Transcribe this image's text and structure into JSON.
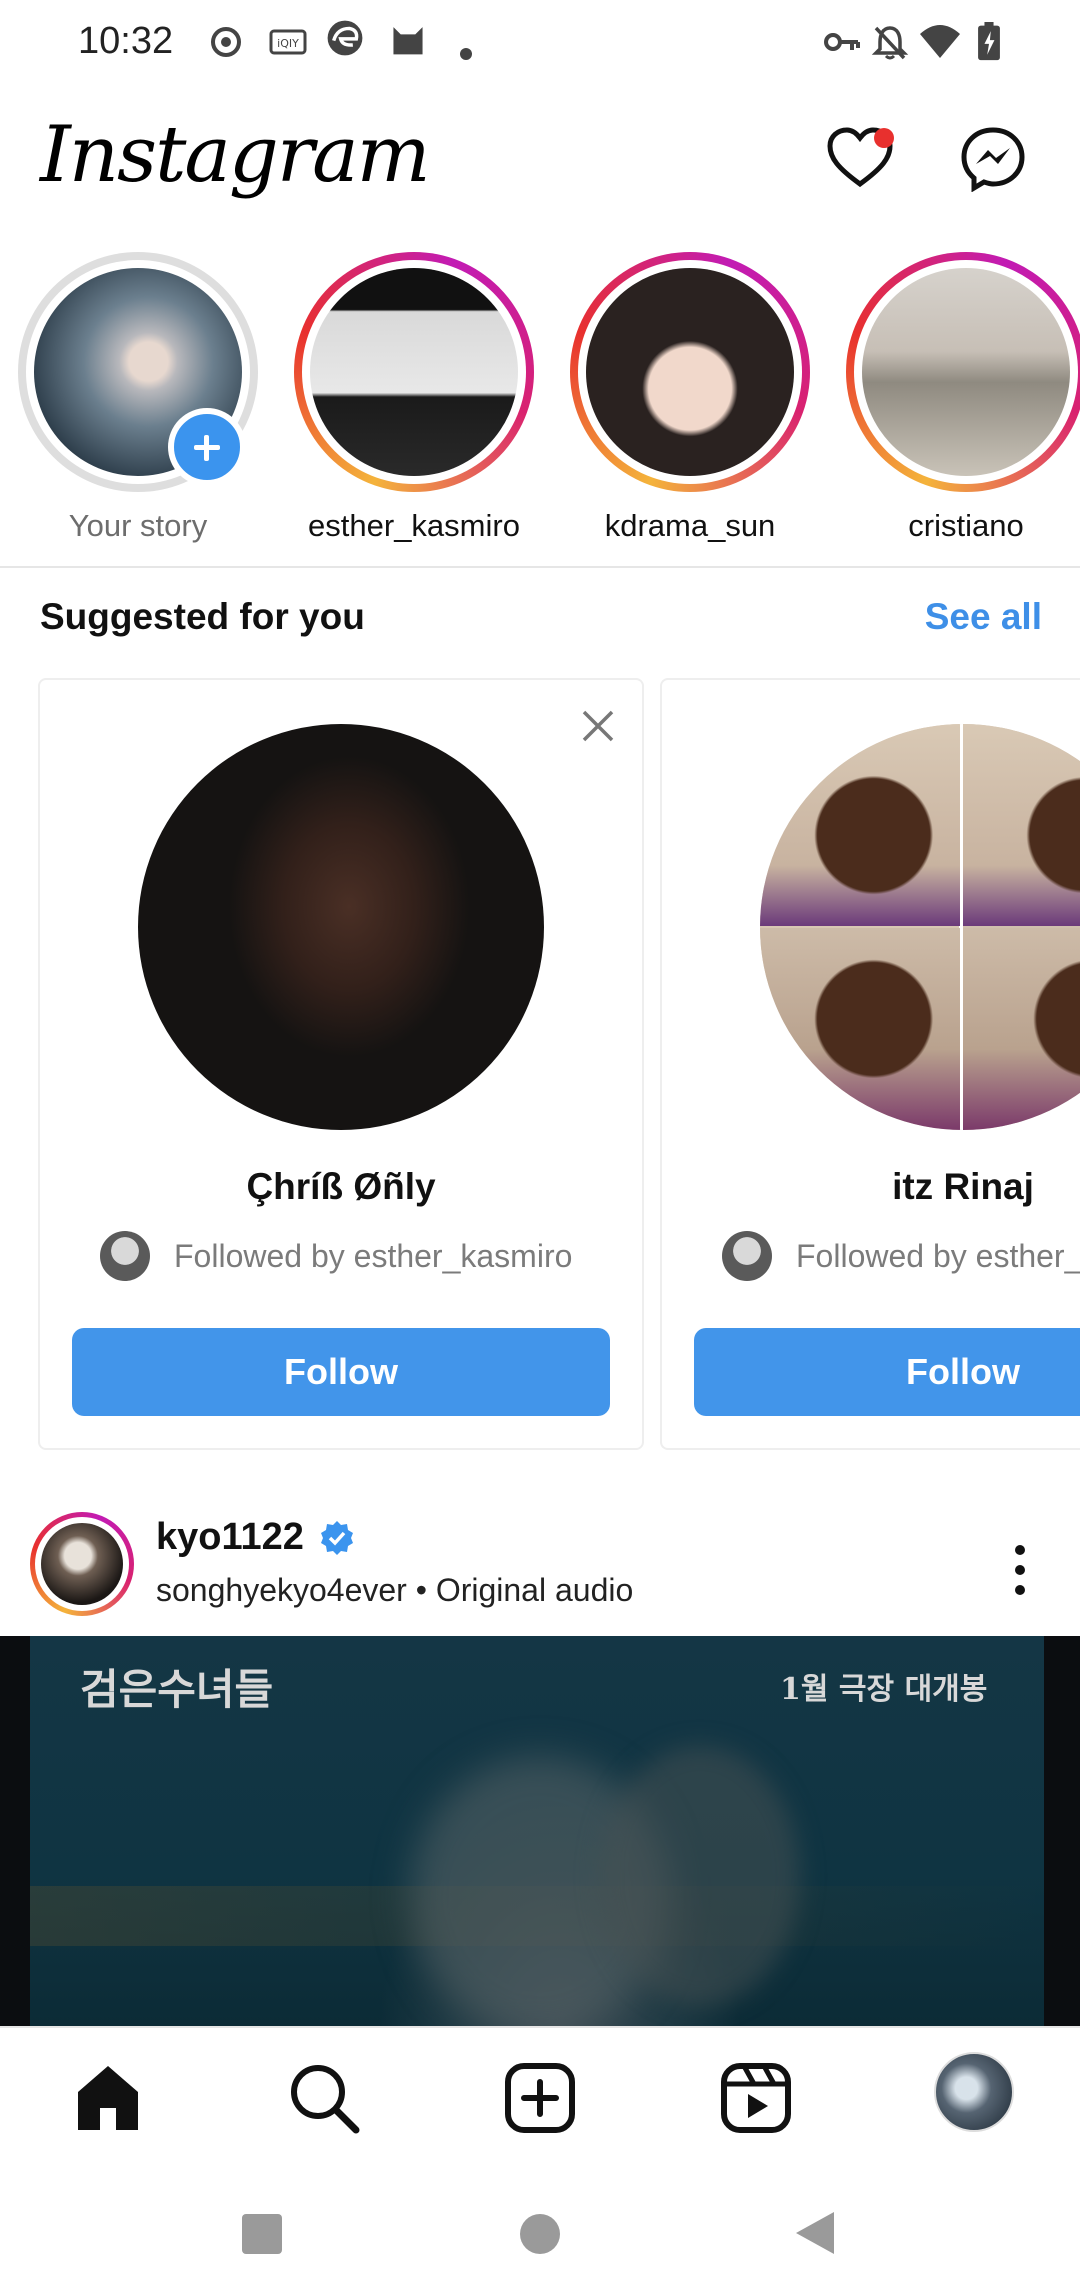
{
  "status_bar": {
    "time": "10:32"
  },
  "header": {
    "logo": "Instagram"
  },
  "stories": [
    {
      "name": "Your story",
      "own": true
    },
    {
      "name": "esther_kasmiro",
      "own": false
    },
    {
      "name": "kdrama_sun",
      "own": false
    },
    {
      "name": "cristiano",
      "own": false
    }
  ],
  "suggestions": {
    "title": "Suggested for you",
    "see_all": "See all",
    "cards": [
      {
        "name": "Çhríß Øñly",
        "followed_by": "Followed by esther_kasmiro",
        "button": "Follow"
      },
      {
        "name": "itz Rinaj",
        "followed_by": "Followed by esther_kasmiro",
        "button": "Follow"
      }
    ]
  },
  "post": {
    "username": "kyo1122",
    "verified": true,
    "subtitle": "songhyekyo4ever • Original audio",
    "image_text_left": "검은수녀들",
    "image_text_right": "1월 극장 대개봉"
  },
  "bottom_nav": [
    "home",
    "search",
    "create",
    "reels",
    "profile"
  ],
  "colors": {
    "accent": "#3e8fe7",
    "follow_button": "#4295ea",
    "notification_dot": "#e8302e"
  }
}
